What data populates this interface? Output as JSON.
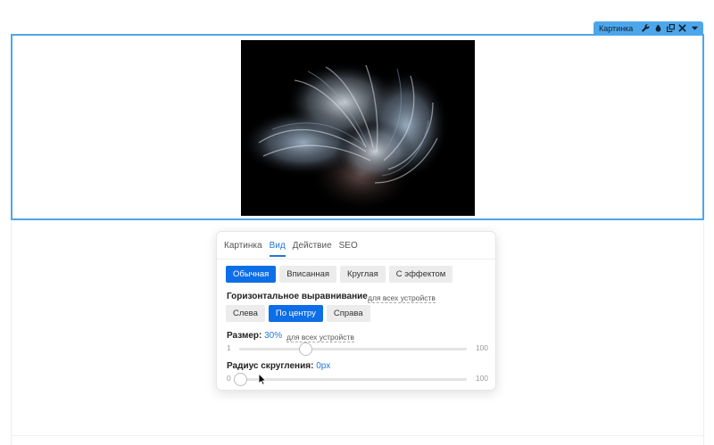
{
  "element_toolbar": {
    "title": "Картинка",
    "icons": [
      "wrench-icon",
      "drop-icon",
      "duplicate-icon",
      "close-icon",
      "chevron-down-icon"
    ]
  },
  "image_block": {
    "content": "fractal-feather-artwork"
  },
  "panel": {
    "tabs": [
      "Картинка",
      "Вид",
      "Действие",
      "SEO"
    ],
    "active_tab": "Вид",
    "styles": {
      "options": [
        "Обычная",
        "Вписанная",
        "Круглая",
        "С эффектом"
      ],
      "selected": "Обычная"
    },
    "alignment": {
      "label": "Горизонтальное выравнивание",
      "scope": "для всех устройств",
      "options": [
        "Слева",
        "По центру",
        "Справа"
      ],
      "selected": "По центру"
    },
    "size": {
      "label": "Размер:",
      "value": "30%",
      "scope": "для всех устройств",
      "min": "1",
      "max": "100",
      "level": 30
    },
    "radius": {
      "label": "Радиус скругления:",
      "value": "0px",
      "min": "0",
      "max": "100",
      "level": 0
    }
  },
  "colors": {
    "selection": "#4ea6ea",
    "accent": "#0d6ee8",
    "link": "#2577d8"
  }
}
